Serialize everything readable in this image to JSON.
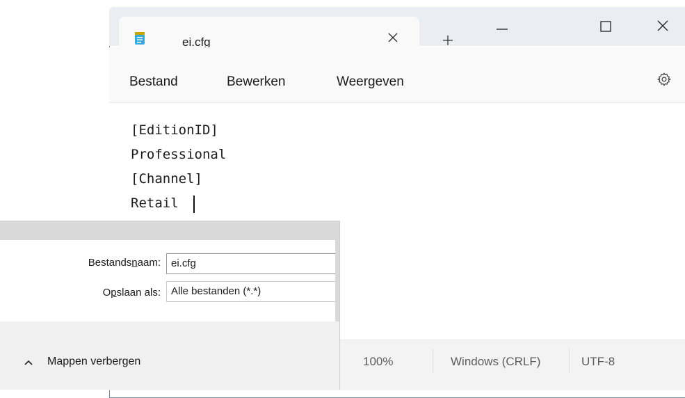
{
  "notepad": {
    "tab": {
      "title": "ei.cfg"
    },
    "window": {
      "close_glyph": "✕",
      "new_tab_glyph": "+"
    },
    "menu": {
      "file": "Bestand",
      "edit": "Bewerken",
      "view": "Weergeven"
    },
    "editor": {
      "lines": [
        "[EditionID]",
        "Professional",
        "[Channel]",
        "Retail"
      ]
    },
    "status": {
      "zoom": "100%",
      "line_ending": "Windows (CRLF)",
      "encoding": "UTF-8"
    }
  },
  "save_dialog": {
    "filename_label_pre": "Bestands",
    "filename_label_accel": "n",
    "filename_label_post": "aam:",
    "filename_value": "ei.cfg",
    "type_label_pre": "O",
    "type_label_accel": "p",
    "type_label_post": "slaan als:",
    "type_value": "Alle bestanden  (*.*)",
    "hide_folders": "Mappen verbergen"
  },
  "colors": {
    "titlebar": "#eaeef3",
    "notepad_icon": "#3aa8d8",
    "notepad_icon_top": "#c9a400"
  }
}
